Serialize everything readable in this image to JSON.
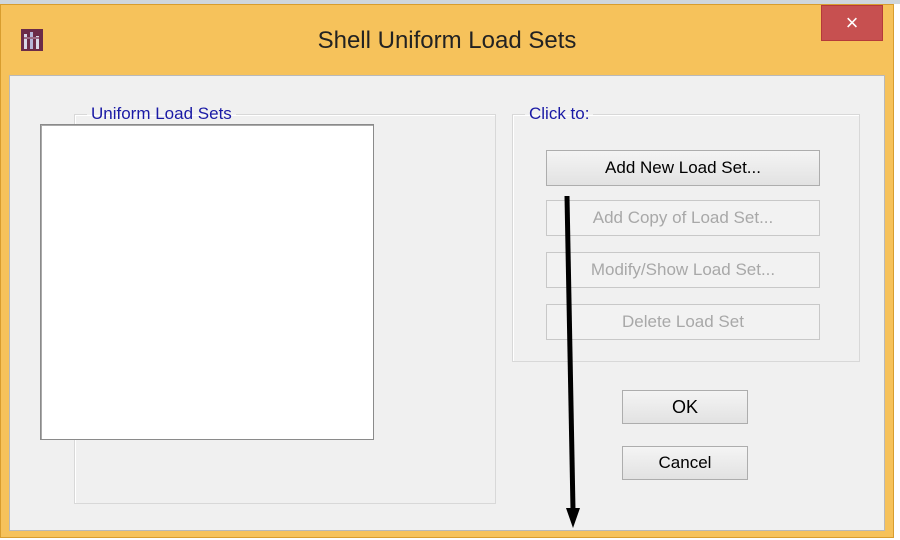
{
  "window": {
    "title": "Shell Uniform Load Sets",
    "close_label": "×"
  },
  "groups": {
    "sets_legend": "Uniform Load Sets",
    "click_legend": "Click to:"
  },
  "buttons": {
    "add_new": "Add New Load Set...",
    "add_copy": "Add Copy of Load Set...",
    "modify_show": "Modify/Show Load Set...",
    "delete": "Delete Load Set",
    "ok": "OK",
    "cancel": "Cancel"
  },
  "list": {
    "items": []
  },
  "colors": {
    "frame": "#f6c25b",
    "close": "#c75050",
    "legend_text": "#1a1aa5"
  },
  "icons": {
    "app": "etabs-app-icon",
    "annotation": "down-arrow-annotation"
  }
}
